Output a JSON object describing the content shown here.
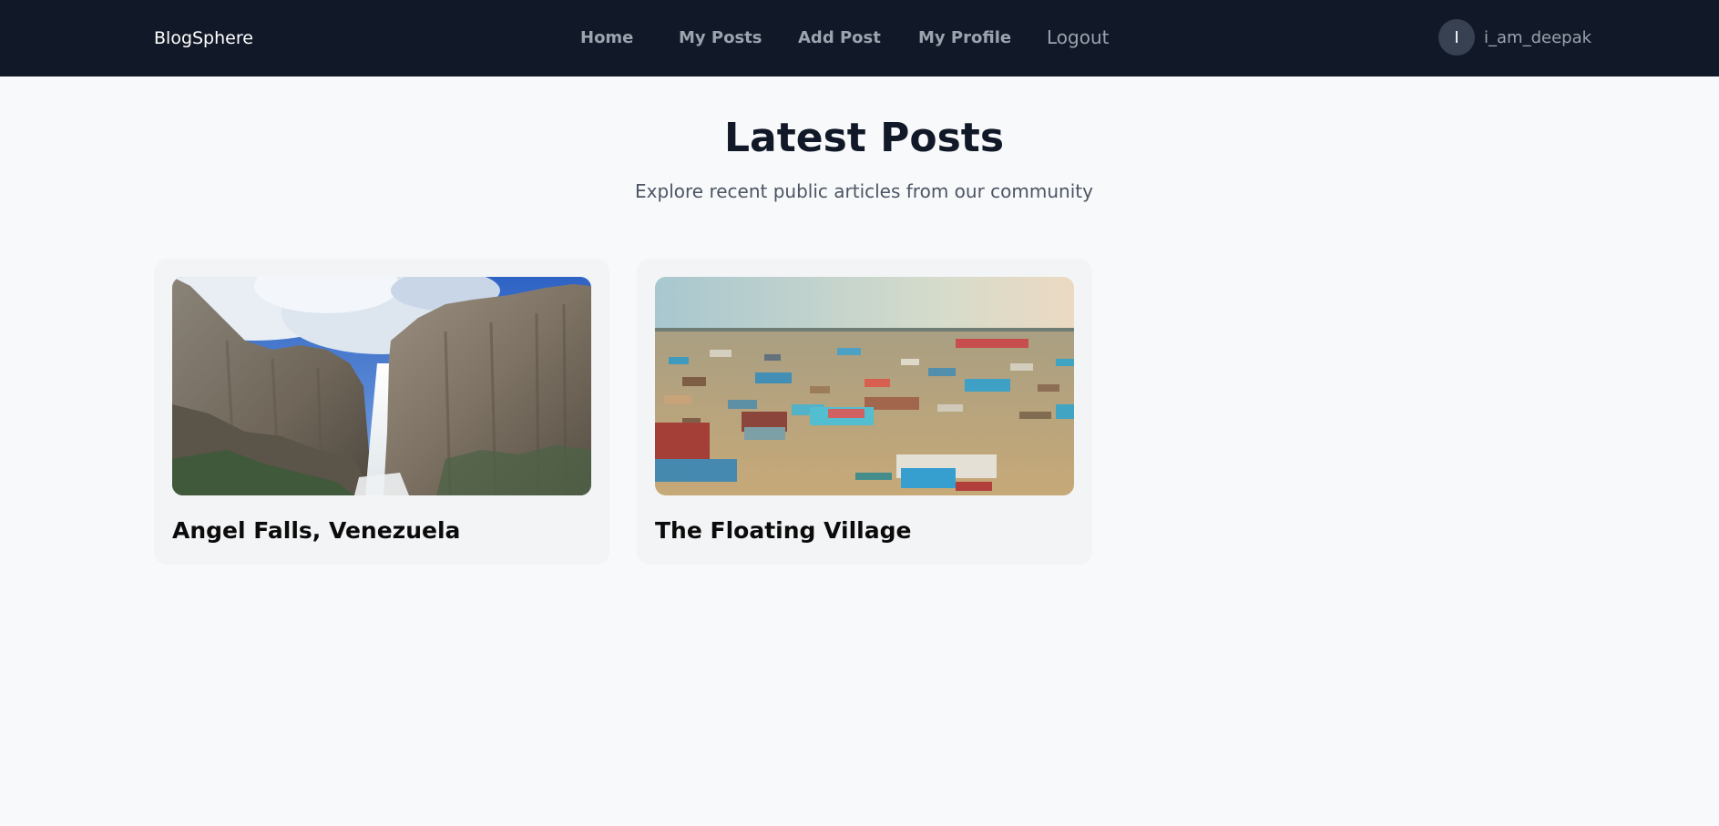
{
  "app": {
    "brand": "BlogSphere"
  },
  "nav": {
    "items": [
      {
        "label": "Home"
      },
      {
        "label": "My Posts"
      },
      {
        "label": "Add Post"
      },
      {
        "label": "My Profile"
      },
      {
        "label": "Logout"
      }
    ]
  },
  "user": {
    "avatar_initial": "I",
    "username": "i_am_deepak"
  },
  "hero": {
    "title": "Latest Posts",
    "subtitle": "Explore recent public articles from our community"
  },
  "posts": [
    {
      "title": "Angel Falls, Venezuela",
      "image": "waterfall-cliffs-photo"
    },
    {
      "title": "The Floating Village",
      "image": "floating-village-boats-photo"
    }
  ],
  "colors": {
    "navbar_bg": "#111827",
    "page_bg": "#f8f9fb",
    "card_bg": "#f3f4f6",
    "nav_text": "#9ca3af",
    "heading": "#111827"
  }
}
